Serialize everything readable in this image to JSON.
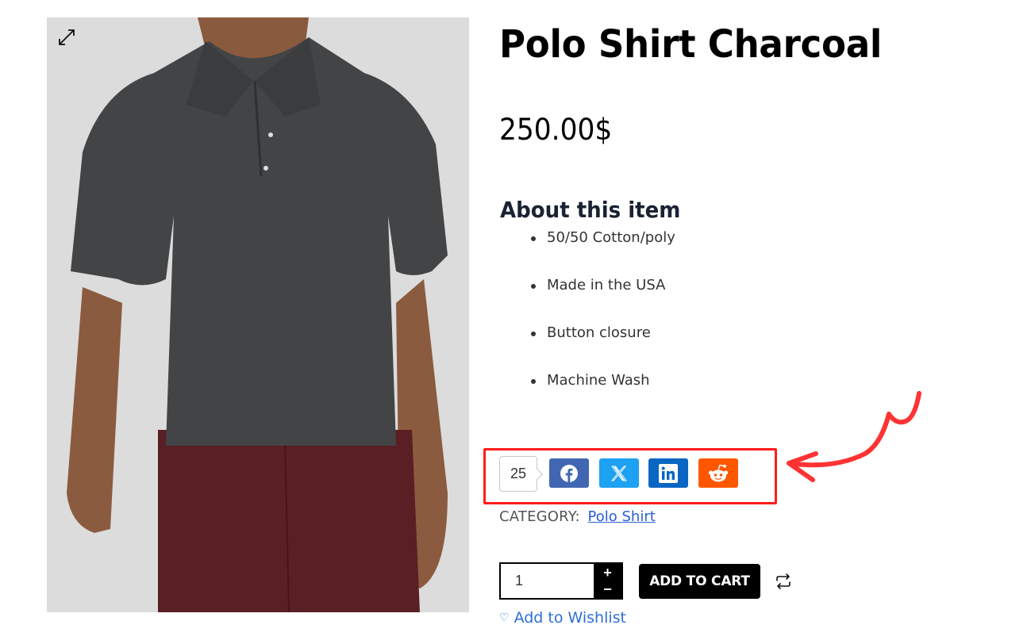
{
  "product": {
    "title": "Polo Shirt Charcoal",
    "price": "250.00$",
    "image_alt": "Charcoal polo shirt worn by model with burgundy shorts"
  },
  "about": {
    "heading": "About this item",
    "features": [
      "50/50 Cotton/poly",
      "Made in the USA",
      "Button closure",
      "Machine Wash"
    ]
  },
  "share": {
    "count": "25",
    "buttons": [
      {
        "network": "Facebook",
        "icon": "facebook-icon",
        "color": "#4267b2"
      },
      {
        "network": "X",
        "icon": "x-icon",
        "color": "#1da1f2"
      },
      {
        "network": "LinkedIn",
        "icon": "linkedin-icon",
        "color": "#0a66c2"
      },
      {
        "network": "Reddit",
        "icon": "reddit-icon",
        "color": "#ff5700"
      }
    ],
    "highlight_color": "#ff1b1b"
  },
  "category": {
    "label": "CATEGORY:",
    "value": "Polo Shirt"
  },
  "cart": {
    "quantity": "1",
    "plus": "+",
    "minus": "−",
    "add_to_cart": "ADD TO CART",
    "wishlist_heart": "♡",
    "wishlist": "Add to Wishlist"
  },
  "colors": {
    "link": "#2c5fd6",
    "button_bg": "#000000"
  }
}
